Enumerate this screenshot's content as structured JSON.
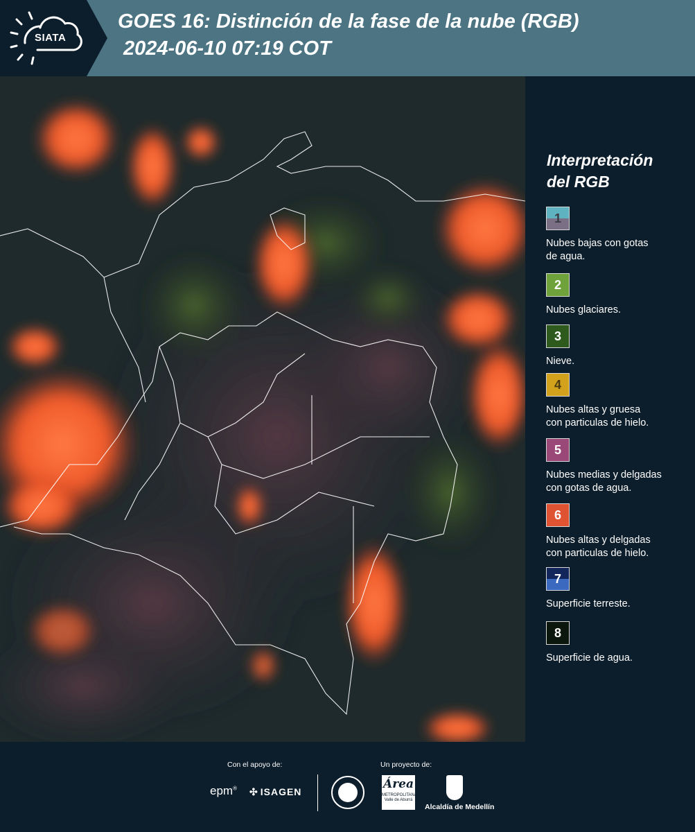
{
  "header": {
    "logo_text": "SIATA",
    "title_line1": "GOES 16: Distinción de la fase de la nube (RGB)",
    "title_line2": "2024-06-10 07:19 COT",
    "background_color": "#4c7482"
  },
  "legend": {
    "title_line1": "Interpretación",
    "title_line2": "del RGB",
    "items": [
      {
        "number": "1",
        "label_line1": "Nubes bajas con gotas",
        "label_line2": "de agua.",
        "color_top": "#5fb2c0",
        "color_bottom": "#7a6f85"
      },
      {
        "number": "2",
        "label_line1": "Nubes glaciares.",
        "label_line2": "",
        "color_top": "#6fa23a",
        "color_bottom": "#6fa23a"
      },
      {
        "number": "3",
        "label_line1": "Nieve.",
        "label_line2": "",
        "color_top": "#2f5a1d",
        "color_bottom": "#2f5a1d"
      },
      {
        "number": "4",
        "label_line1": "Nubes altas y gruesa",
        "label_line2": "con particulas de hielo.",
        "color_top": "#d3a21c",
        "color_bottom": "#d3a21c"
      },
      {
        "number": "5",
        "label_line1": "Nubes medias y delgadas",
        "label_line2": "con gotas de agua.",
        "color_top": "#9a4877",
        "color_bottom": "#9a4877"
      },
      {
        "number": "6",
        "label_line1": "Nubes altas y delgadas",
        "label_line2": "con particulas de hielo.",
        "color_top": "#df5333",
        "color_bottom": "#df5333"
      },
      {
        "number": "7",
        "label_line1": "Superficie terreste.",
        "label_line2": "",
        "color_top": "#13265c",
        "color_bottom": "#3c69c0"
      },
      {
        "number": "8",
        "label_line1": "Superficie de agua.",
        "label_line2": "",
        "color_top": "#0b160d",
        "color_bottom": "#0b160d"
      }
    ]
  },
  "footer": {
    "sponsor_caption": "Con el apoyo de:",
    "project_caption": "Un proyecto de:",
    "epm_logo": "epm",
    "isagen_logo": "ISAGEN",
    "area_logo_big": "Área",
    "area_logo_line1": "METROPOLITANA",
    "area_logo_line2": "Valle de Aburrá",
    "alcaldia_logo": "Alcaldía de Medellín"
  },
  "map": {
    "description_icon": "satellite-rgb-image",
    "cloud_color": "#f05a2a",
    "border_color": "#ffffff"
  }
}
